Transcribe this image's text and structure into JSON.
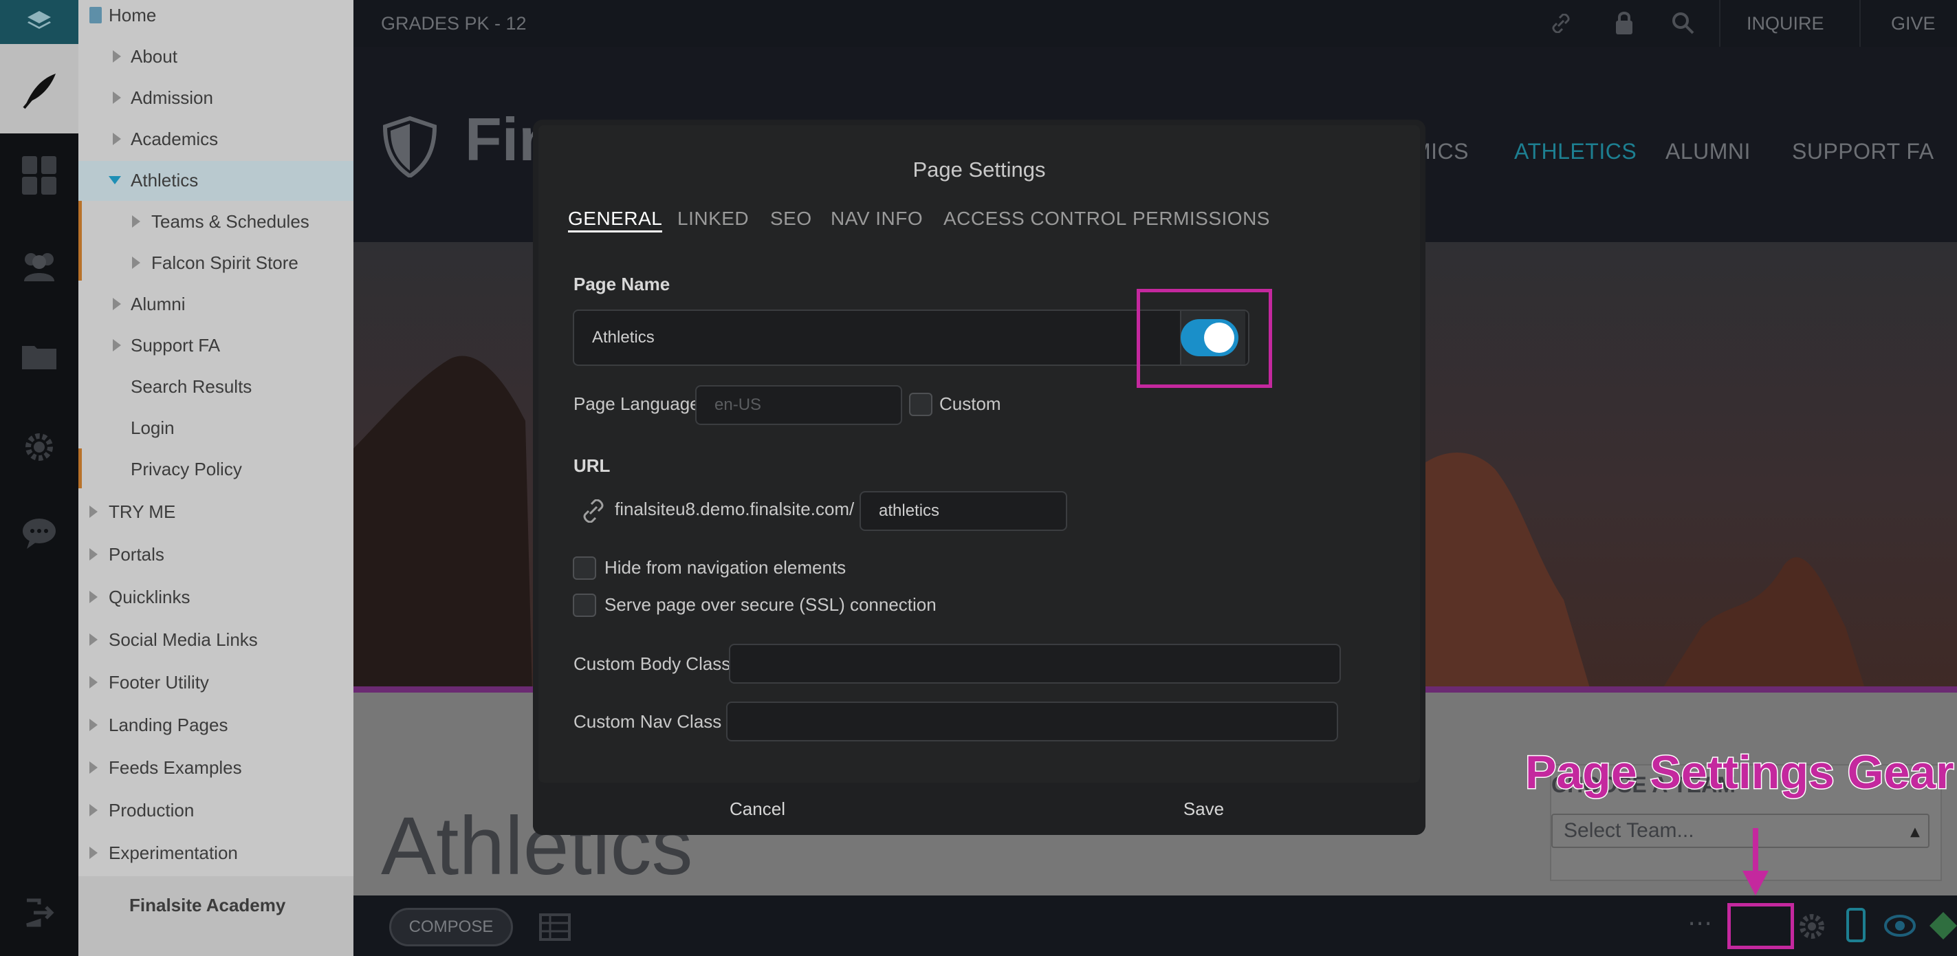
{
  "site": {
    "grades": "GRADES PK - 12",
    "top_links": [
      "INQUIRE",
      "GIVE"
    ],
    "brand_fragment": "Fin",
    "nav": [
      "MICS",
      "ATHLETICS",
      "ALUMNI",
      "SUPPORT FA"
    ],
    "page_heading": "Athletics",
    "team_label": "CHOOSE A TEAM",
    "team_select": "Select Team..."
  },
  "tree": {
    "root": "Home",
    "items": [
      {
        "label": "About"
      },
      {
        "label": "Admission"
      },
      {
        "label": "Academics"
      },
      {
        "label": "Athletics"
      },
      {
        "label": "Teams & Schedules"
      },
      {
        "label": "Falcon Spirit Store"
      },
      {
        "label": "Alumni"
      },
      {
        "label": "Support FA"
      },
      {
        "label": "Search Results"
      },
      {
        "label": "Login"
      },
      {
        "label": "Privacy Policy"
      },
      {
        "label": "TRY ME"
      },
      {
        "label": "Portals"
      },
      {
        "label": "Quicklinks"
      },
      {
        "label": "Social Media Links"
      },
      {
        "label": "Footer Utility"
      },
      {
        "label": "Landing Pages"
      },
      {
        "label": "Feeds Examples"
      },
      {
        "label": "Production"
      },
      {
        "label": "Experimentation"
      }
    ],
    "footer": "Finalsite Academy"
  },
  "modal": {
    "title": "Page Settings",
    "tabs": [
      "GENERAL",
      "LINKED",
      "SEO",
      "NAV INFO",
      "ACCESS CONTROL",
      "PERMISSIONS"
    ],
    "page_name_label": "Page Name",
    "page_name_value": "Athletics",
    "page_language_label": "Page Language",
    "page_language_placeholder": "en-US",
    "custom_label": "Custom",
    "url_label": "URL",
    "url_base": "finalsiteu8.demo.finalsite.com/",
    "url_slug": "athletics",
    "hide_nav_label": "Hide from navigation elements",
    "ssl_label": "Serve page over secure (SSL) connection",
    "body_class_label": "Custom Body Class",
    "nav_class_label": "Custom Nav Class",
    "cancel": "Cancel",
    "save": "Save"
  },
  "bottom_bar": {
    "compose": "COMPOSE"
  },
  "annotation": {
    "text": "Page Settings Gear",
    "color": "#c4289e"
  },
  "colors": {
    "toggle_on": "#1a8fc9",
    "accent_teal": "#1d7f91",
    "tree_selected": "#b9c9cf"
  }
}
